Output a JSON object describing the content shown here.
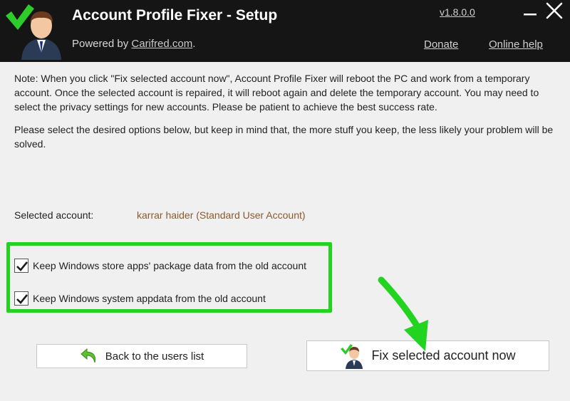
{
  "header": {
    "title": "Account Profile Fixer - Setup",
    "powered_prefix": "Powered by ",
    "powered_link": "Carifred.com",
    "powered_suffix": ".",
    "version": "v1.8.0.0",
    "donate": "Donate",
    "online_help": "Online help"
  },
  "note": {
    "paragraph1": "Note: When you click \"Fix selected account now\", Account Profile Fixer will reboot the PC and work from a temporary account. Once the selected account is repaired, it will reboot again and delete the temporary account. You may need to select the privacy settings for new accounts. Please be patient to achieve the best success rate.",
    "paragraph2": "Please select the desired options below, but keep in mind that, the more stuff you keep, the less likely your problem will be solved."
  },
  "account": {
    "label": "Selected account:",
    "value": "karrar haider (Standard User Account)"
  },
  "options": [
    {
      "label": "Keep Windows store apps' package data from the old account",
      "checked": true
    },
    {
      "label": "Keep Windows system appdata from the old account",
      "checked": true
    }
  ],
  "buttons": {
    "back": "Back to the users list",
    "fix": "Fix selected account now"
  },
  "colors": {
    "titlebar": "#151515",
    "highlight": "#22d31f",
    "account_value": "#8a5a2b"
  }
}
